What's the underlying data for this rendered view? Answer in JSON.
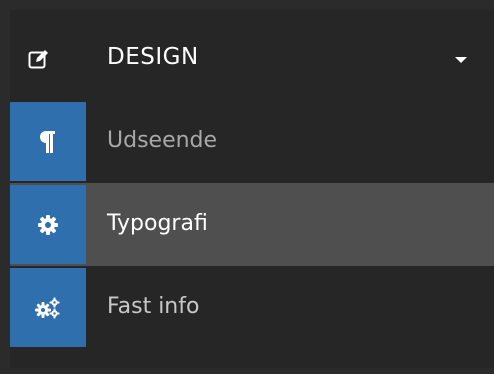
{
  "menu": {
    "section": {
      "label": "DESIGN",
      "icon": "edit-icon",
      "caret_icon": "caret-down-icon"
    },
    "items": [
      {
        "label": "Udseende",
        "icon": "paragraph-icon",
        "active": false
      },
      {
        "label": "Typografi",
        "icon": "gear-icon",
        "active": true
      },
      {
        "label": "Fast info",
        "icon": "gears-icon",
        "active": false
      }
    ]
  },
  "colors": {
    "background": "#262626",
    "active_row": "#4f4f4f",
    "icon_box": "#2f6fae",
    "text": "#ffffff",
    "muted_text": "#a8a8a8"
  }
}
